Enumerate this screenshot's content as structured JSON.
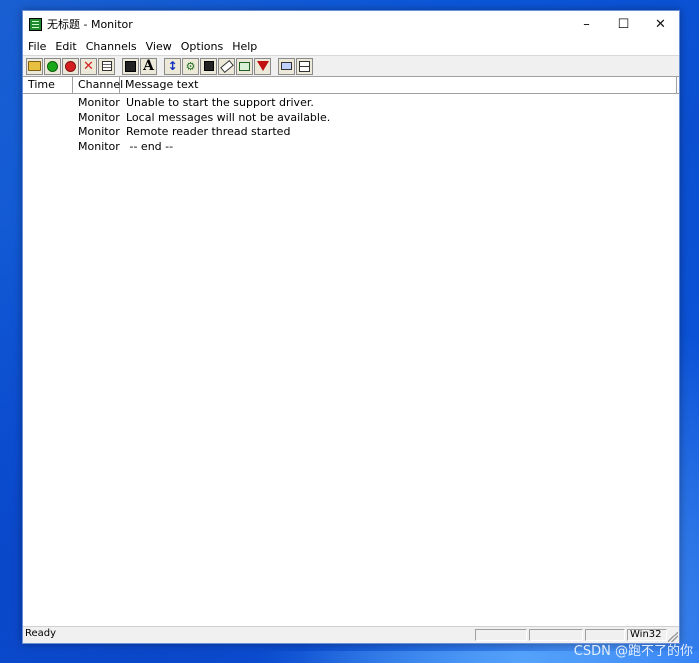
{
  "window": {
    "title": "无标题 - Monitor",
    "controls": {
      "minimize": "–",
      "maximize": "☐",
      "close": "✕"
    }
  },
  "menu": {
    "items": [
      "File",
      "Edit",
      "Channels",
      "View",
      "Options",
      "Help"
    ]
  },
  "toolbar": {
    "buttons": [
      {
        "icon": "open-folder-icon",
        "glyph": "📂"
      },
      {
        "icon": "go-green-icon",
        "glyph": "●"
      },
      {
        "icon": "stop-icon",
        "glyph": "●"
      },
      {
        "icon": "delete-x-icon",
        "glyph": "✕"
      },
      {
        "icon": "properties-icon",
        "glyph": "▦"
      },
      {
        "icon": "save-icon",
        "glyph": "▪"
      },
      {
        "icon": "font-icon",
        "glyph": "A"
      },
      {
        "icon": "scroll-icon",
        "glyph": "↕"
      },
      {
        "icon": "find-icon",
        "glyph": "⚙"
      },
      {
        "icon": "save-log-icon",
        "glyph": "▪"
      },
      {
        "icon": "erase-icon",
        "glyph": "⌫"
      },
      {
        "icon": "edit-window-icon",
        "glyph": "✎"
      },
      {
        "icon": "filter-icon",
        "glyph": "▼"
      },
      {
        "icon": "printer-icon",
        "glyph": "▭"
      },
      {
        "icon": "network-icon",
        "glyph": "⊞"
      }
    ]
  },
  "columns": {
    "time": "Time",
    "channel": "Channel",
    "message": "Message text"
  },
  "rows": [
    {
      "time": "",
      "channel": "Monitor",
      "message": "Unable to start the support driver."
    },
    {
      "time": "",
      "channel": "Monitor",
      "message": "Local messages will not be available."
    },
    {
      "time": "",
      "channel": "Monitor",
      "message": "Remote reader thread started"
    },
    {
      "time": "",
      "channel": "Monitor",
      "message": " -- end --"
    }
  ],
  "status": {
    "text": "Ready",
    "pane_last": "Win32 I"
  },
  "watermark": "CSDN @跑不了的你",
  "colors": {
    "desktop": "#0b56d9",
    "stop_red": "#d42020",
    "go_green": "#1aa81a",
    "filter_red": "#c01010",
    "scroll_blue": "#1030c0"
  }
}
